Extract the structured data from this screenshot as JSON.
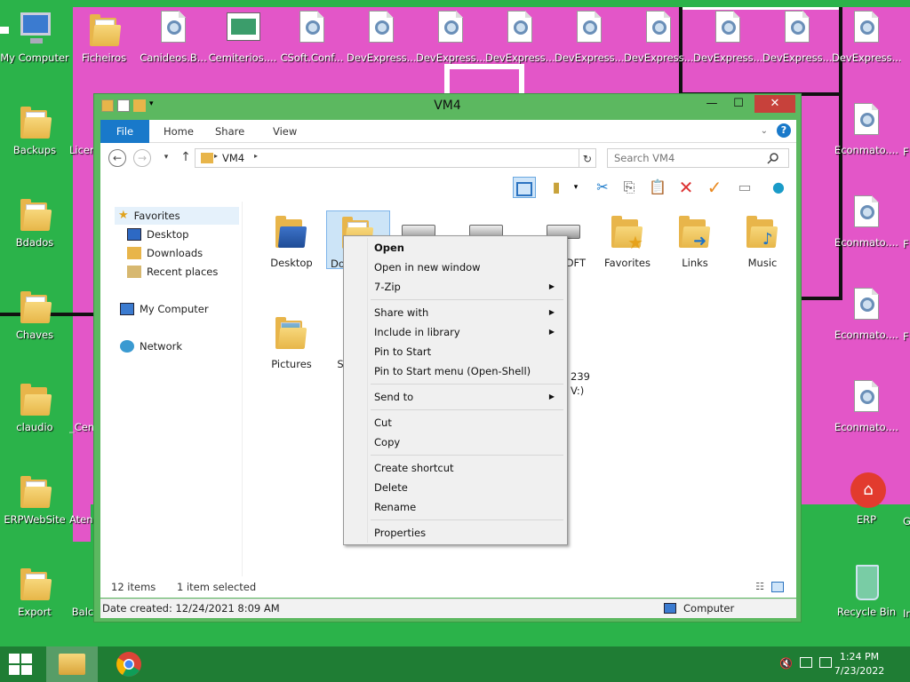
{
  "desktop": {
    "icons": [
      {
        "label": "My Computer"
      },
      {
        "label": "Ficheiros"
      },
      {
        "label": "Canideos.B..."
      },
      {
        "label": "Cemiterios...."
      },
      {
        "label": "CSoft.Conf..."
      },
      {
        "label": "DevExpress...."
      },
      {
        "label": "DevExpress...."
      },
      {
        "label": "DevExpress...."
      },
      {
        "label": "DevExpress...."
      },
      {
        "label": "DevExpress...."
      },
      {
        "label": "DevExpress...."
      },
      {
        "label": "DevExpress...."
      },
      {
        "label": "DevExpress...."
      },
      {
        "label": "Backups"
      },
      {
        "label": "Bdados"
      },
      {
        "label": "Chaves"
      },
      {
        "label": "claudio"
      },
      {
        "label": "ERPWebSite"
      },
      {
        "label": "Export"
      },
      {
        "label": "Econmato...."
      },
      {
        "label": "Econmato...."
      },
      {
        "label": "Econmato...."
      },
      {
        "label": "Econmato...."
      },
      {
        "label": "ERP"
      },
      {
        "label": "Recycle Bin"
      },
      {
        "label": "Licen"
      },
      {
        "label": "_Cem"
      },
      {
        "label": "Atend"
      },
      {
        "label": "Balc"
      },
      {
        "label": "F"
      },
      {
        "label": "F"
      },
      {
        "label": "F"
      },
      {
        "label": "G"
      },
      {
        "label": "Ir"
      }
    ]
  },
  "window": {
    "title": "VM4",
    "controls": {
      "minimize": "—",
      "maximize": "☐",
      "close": "✕"
    },
    "ribbon_tabs": {
      "file": "File",
      "home": "Home",
      "share": "Share",
      "view": "View"
    },
    "address": {
      "path": "VM4"
    },
    "search": {
      "placeholder": "Search VM4"
    },
    "nav_pane": {
      "favorites": "Favorites",
      "desktop": "Desktop",
      "downloads": "Downloads",
      "recent": "Recent places",
      "computer": "My Computer",
      "network": "Network"
    },
    "items": [
      {
        "label": "Desktop"
      },
      {
        "label": "Doc"
      },
      {
        "label": ""
      },
      {
        "label": ""
      },
      {
        "label": "DFT"
      },
      {
        "label": "Favorites"
      },
      {
        "label": "Links"
      },
      {
        "label": "Music"
      },
      {
        "label": "Pictures"
      },
      {
        "label": "S"
      }
    ],
    "drive_partial": {
      "line1": "239",
      "line2": "V:)"
    },
    "status": {
      "count": "12 items",
      "selected": "1 item selected"
    },
    "details": {
      "created": "Date created: 12/24/2021 8:09 AM",
      "location": "Computer"
    }
  },
  "context_menu": {
    "items": [
      {
        "label": "Open"
      },
      {
        "label": "Open in new window"
      },
      {
        "label": "7-Zip"
      },
      {
        "label": "Share with"
      },
      {
        "label": "Include in library"
      },
      {
        "label": "Pin to Start"
      },
      {
        "label": "Pin to Start menu (Open-Shell)"
      },
      {
        "label": "Send to"
      },
      {
        "label": "Cut"
      },
      {
        "label": "Copy"
      },
      {
        "label": "Create shortcut"
      },
      {
        "label": "Delete"
      },
      {
        "label": "Rename"
      },
      {
        "label": "Properties"
      }
    ],
    "arrow": "▶"
  },
  "taskbar": {
    "time": "1:24 PM",
    "date": "7/23/2022"
  },
  "colors": {
    "desktop_green": "#2bb34a",
    "magenta": "#e356c8",
    "window_frame": "#5cb860",
    "file_tab": "#1979ca",
    "close": "#c7413b"
  }
}
